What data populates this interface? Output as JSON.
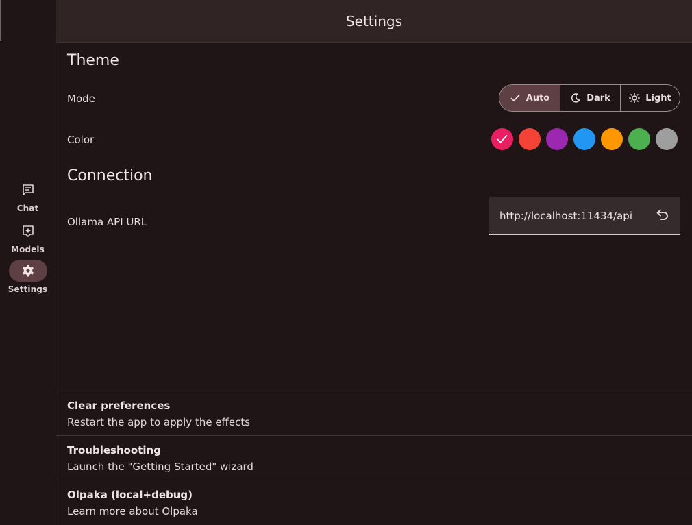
{
  "nav": {
    "items": [
      {
        "label": "Chat",
        "icon": "chat-icon"
      },
      {
        "label": "Models",
        "icon": "models-icon"
      },
      {
        "label": "Settings",
        "icon": "gear-icon",
        "active": true
      }
    ]
  },
  "appbar": {
    "title": "Settings"
  },
  "theme": {
    "title": "Theme",
    "mode_label": "Mode",
    "modes": [
      {
        "label": "Auto",
        "icon": "check-icon",
        "selected": true
      },
      {
        "label": "Dark",
        "icon": "moon-icon"
      },
      {
        "label": "Light",
        "icon": "sun-icon"
      }
    ],
    "color_label": "Color",
    "colors": [
      "#e91e63",
      "#f44336",
      "#9c27b0",
      "#2196f3",
      "#ff9800",
      "#4caf50",
      "#9e9e9e"
    ],
    "selected_color": "#e91e63"
  },
  "connection": {
    "title": "Connection",
    "api_label": "Ollama API URL",
    "api_url": "http://localhost:11434/api",
    "reset_icon": "undo-icon"
  },
  "tiles": [
    {
      "title": "Clear preferences",
      "subtitle": "Restart the app to apply the effects"
    },
    {
      "title": "Troubleshooting",
      "subtitle": "Launch the \"Getting Started\" wizard"
    },
    {
      "title": "Olpaka (local+debug)",
      "subtitle": "Learn more about Olpaka"
    }
  ],
  "colors": {
    "accent_container": "#5d3f44",
    "background": "#1f1516",
    "appbar": "#302425"
  }
}
